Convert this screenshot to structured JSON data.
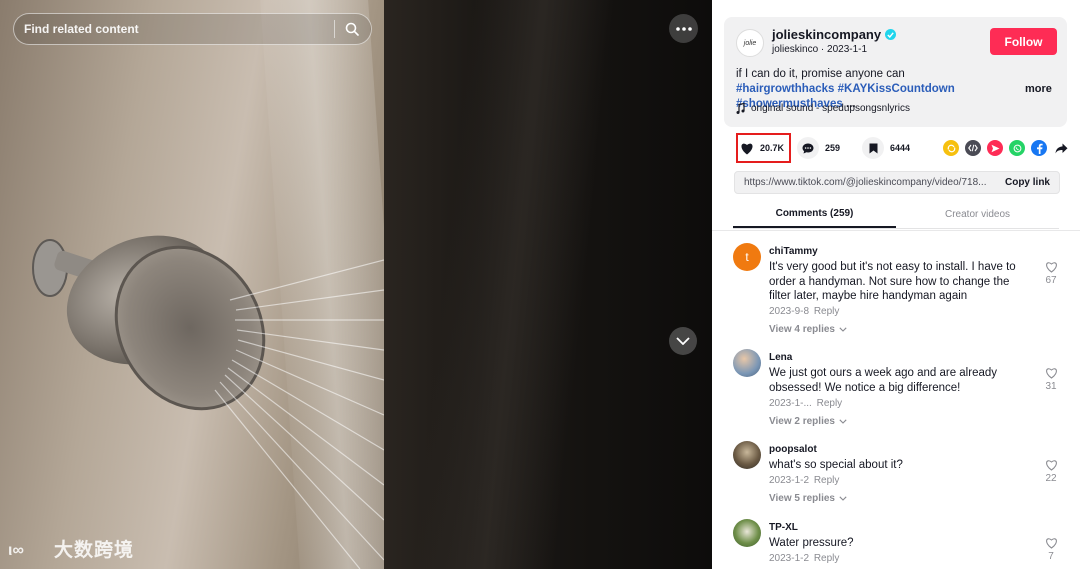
{
  "search": {
    "placeholder": "Find related content"
  },
  "watermark": {
    "text": "大数跨境"
  },
  "author": {
    "avatar_text": "jolie",
    "username": "jolieskincompany",
    "handle": "jolieskinco",
    "date": "2023-1-1",
    "follow_label": "Follow"
  },
  "description": {
    "text": "if I can do it, promise anyone can",
    "tags": [
      "#hairgrowthhacks",
      "#KAYKissCountdown",
      "#showermusthaves",
      "..."
    ],
    "more_label": "more"
  },
  "sound": {
    "label": "original sound - spedupsongsnlyrics"
  },
  "actions": {
    "likes": "20.7K",
    "comments": "259",
    "saves": "6444"
  },
  "share_icons": [
    {
      "name": "repost-icon",
      "color": "#f6c00f"
    },
    {
      "name": "embed-icon",
      "color": "#4a4b55"
    },
    {
      "name": "send-icon",
      "color": "#fe2c55"
    },
    {
      "name": "whatsapp-icon",
      "color": "#25d366"
    },
    {
      "name": "facebook-icon",
      "color": "#1877f2"
    },
    {
      "name": "arrow-share-icon",
      "color": "#161823"
    }
  ],
  "link": {
    "url": "https://www.tiktok.com/@jolieskincompany/video/718...",
    "copy_label": "Copy link"
  },
  "tabs": [
    {
      "label": "Comments (259)",
      "active": true
    },
    {
      "label": "Creator videos",
      "active": false
    }
  ],
  "comments": [
    {
      "name": "chiTammy",
      "text": "It's very good but it's not easy to install. I have to order a handyman. Not sure how to change the filter later, maybe hire handyman again",
      "date": "2023-9-8",
      "reply": "Reply",
      "views": "View 4 replies",
      "likes": "67"
    },
    {
      "name": "Lena",
      "text": "We just got ours a week ago and are already obsessed! We notice a big difference!",
      "date": "2023-1-...",
      "reply": "Reply",
      "views": "View 2 replies",
      "likes": "31"
    },
    {
      "name": "poopsalot",
      "text": "what's so special about it?",
      "date": "2023-1-2",
      "reply": "Reply",
      "views": "View 5 replies",
      "likes": "22"
    },
    {
      "name": "TP-XL",
      "text": "Water pressure?",
      "date": "2023-1-2",
      "reply": "Reply",
      "views": "",
      "likes": "7"
    }
  ]
}
